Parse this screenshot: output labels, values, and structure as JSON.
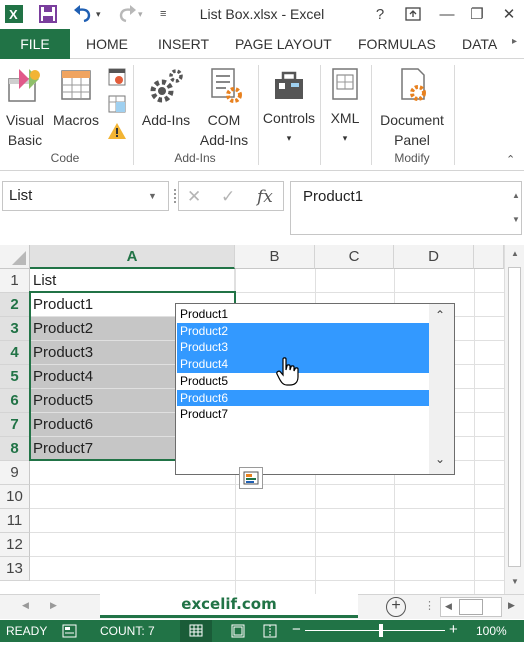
{
  "window": {
    "title": "List Box.xlsx - Excel",
    "help": "?",
    "minimize": "—",
    "restore": "❐",
    "close": "✕"
  },
  "tabs": [
    "FILE",
    "HOME",
    "INSERT",
    "PAGE LAYOUT",
    "FORMULAS",
    "DATA"
  ],
  "ribbon": {
    "code": {
      "label": "Code",
      "visual_basic": [
        "Visual",
        "Basic"
      ],
      "macros": "Macros"
    },
    "addins": {
      "label": "Add-Ins",
      "add_ins": "Add-Ins",
      "com_add_ins": [
        "COM",
        "Add-Ins"
      ]
    },
    "controls": {
      "label": "Controls"
    },
    "xml": {
      "label": "XML"
    },
    "modify": {
      "label": "Modify",
      "document_panel": [
        "Document",
        "Panel"
      ]
    }
  },
  "formula_bar": {
    "name_box": "List",
    "value": "Product1",
    "fx": "fx"
  },
  "columns": [
    "A",
    "B",
    "C",
    "D"
  ],
  "rows": [
    "1",
    "2",
    "3",
    "4",
    "5",
    "6",
    "7",
    "8",
    "9",
    "10",
    "11",
    "12",
    "13"
  ],
  "cells_a": [
    "List",
    "Product1",
    "Product2",
    "Product3",
    "Product4",
    "Product5",
    "Product6",
    "Product7"
  ],
  "listbox": {
    "items": [
      "Product1",
      "Product2",
      "Product3",
      "Product4",
      "Product5",
      "Product6",
      "Product7"
    ],
    "selected": [
      false,
      true,
      true,
      true,
      false,
      true,
      false
    ]
  },
  "sheet_tab": "excelif.com",
  "status": {
    "mode": "READY",
    "count": "COUNT: 7",
    "zoom": "100%"
  },
  "colors": {
    "accent": "#217346",
    "list_selection": "#3399ff",
    "cell_highlight": "#c6c6c6"
  }
}
